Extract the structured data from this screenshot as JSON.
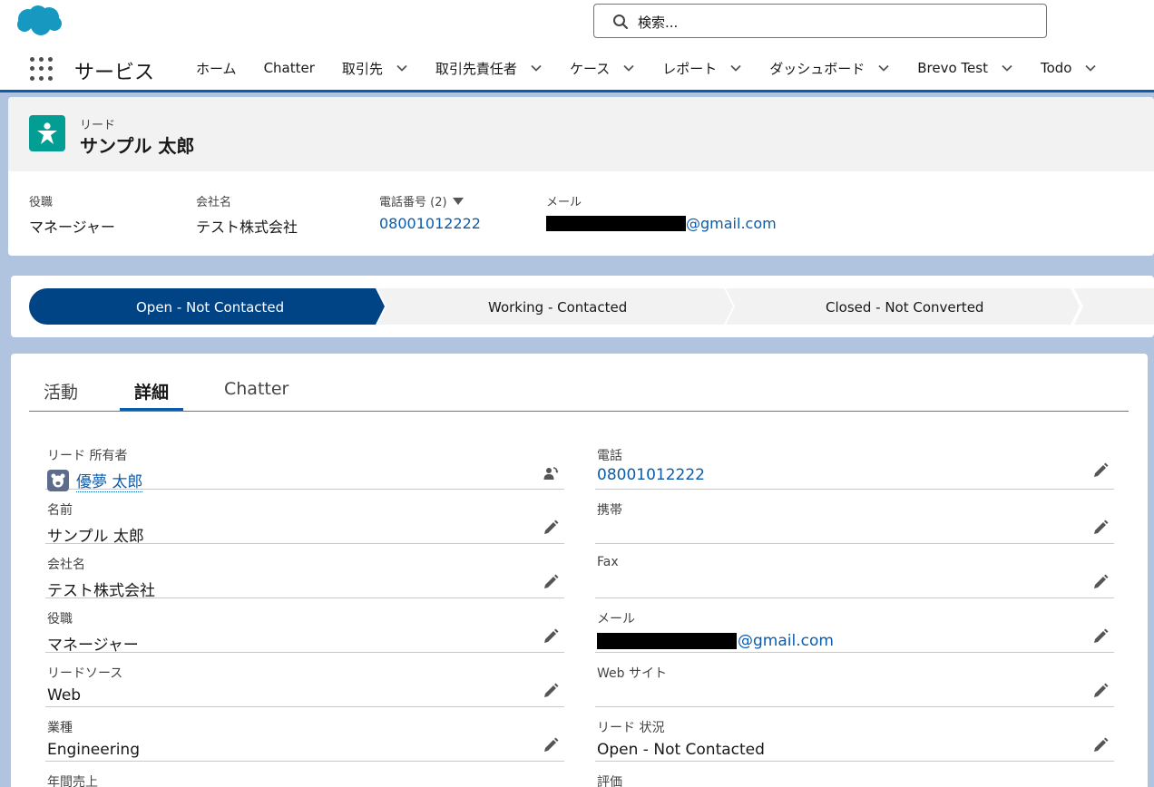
{
  "search": {
    "placeholder": "検索..."
  },
  "nav": {
    "app_name": "サービス",
    "items": [
      {
        "label": "ホーム",
        "has_menu": false
      },
      {
        "label": "Chatter",
        "has_menu": false
      },
      {
        "label": "取引先",
        "has_menu": true
      },
      {
        "label": "取引先責任者",
        "has_menu": true
      },
      {
        "label": "ケース",
        "has_menu": true
      },
      {
        "label": "レポート",
        "has_menu": true
      },
      {
        "label": "ダッシュボード",
        "has_menu": true
      },
      {
        "label": "Brevo Test",
        "has_menu": true
      },
      {
        "label": "Todo",
        "has_menu": true
      }
    ]
  },
  "record": {
    "object_label": "リード",
    "title": "サンプル 太郎",
    "highlights": {
      "title_label": "役職",
      "title_value": "マネージャー",
      "company_label": "会社名",
      "company_value": "テスト株式会社",
      "phone_label": "電話番号 (2)",
      "phone_value": "08001012222",
      "email_label": "メール",
      "email_suffix": "@gmail.com"
    }
  },
  "path": {
    "steps": [
      {
        "label": "Open - Not Contacted",
        "state": "current"
      },
      {
        "label": "Working - Contacted",
        "state": "incomplete"
      },
      {
        "label": "Closed - Not Converted",
        "state": "incomplete"
      }
    ]
  },
  "tabs": [
    {
      "label": "活動"
    },
    {
      "label": "詳細"
    },
    {
      "label": "Chatter"
    }
  ],
  "details": {
    "left": {
      "owner": {
        "label": "リード 所有者",
        "value": "優夢 太郎"
      },
      "name": {
        "label": "名前",
        "value": "サンプル 太郎"
      },
      "company": {
        "label": "会社名",
        "value": "テスト株式会社"
      },
      "title": {
        "label": "役職",
        "value": "マネージャー"
      },
      "source": {
        "label": "リードソース",
        "value": "Web"
      },
      "industry": {
        "label": "業種",
        "value": "Engineering"
      },
      "revenue": {
        "label": "年間売上",
        "value": ""
      }
    },
    "right": {
      "phone": {
        "label": "電話",
        "value": "08001012222"
      },
      "mobile": {
        "label": "携帯",
        "value": ""
      },
      "fax": {
        "label": "Fax",
        "value": ""
      },
      "email": {
        "label": "メール",
        "suffix": "@gmail.com"
      },
      "website": {
        "label": "Web サイト",
        "value": ""
      },
      "status": {
        "label": "リード 状況",
        "value": "Open - Not Contacted"
      },
      "rating": {
        "label": "評価",
        "value": ""
      }
    }
  },
  "colors": {
    "brand_blue": "#0b5cab",
    "path_current": "#014486",
    "lead_icon": "#039e93",
    "cloud": "#1798c1"
  }
}
